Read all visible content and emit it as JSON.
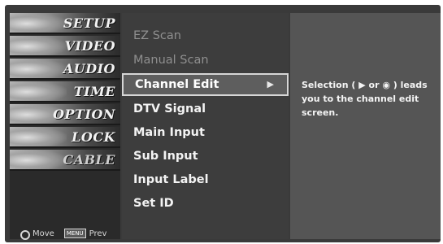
{
  "categories": [
    {
      "label": "SETUP",
      "icon": "setup-icon"
    },
    {
      "label": "VIDEO",
      "icon": "video-icon"
    },
    {
      "label": "AUDIO",
      "icon": "audio-icon"
    },
    {
      "label": "TIME",
      "icon": "clock-icon"
    },
    {
      "label": "OPTION",
      "icon": "option-icon"
    },
    {
      "label": "LOCK",
      "icon": "lock-icon"
    },
    {
      "label": "CABLE",
      "icon": "cable-icon"
    }
  ],
  "legend": {
    "move_label": "Move",
    "prev_key": "MENU",
    "prev_label": "Prev"
  },
  "menu": {
    "items": [
      {
        "label": "EZ Scan",
        "state": "disabled"
      },
      {
        "label": "Manual Scan",
        "state": "disabled"
      },
      {
        "label": "Channel Edit",
        "state": "selected",
        "arrow": "▶"
      },
      {
        "label": "DTV Signal",
        "state": "normal"
      },
      {
        "label": "Main Input",
        "state": "normal"
      },
      {
        "label": "Sub Input",
        "state": "normal"
      },
      {
        "label": "Input Label",
        "state": "normal"
      },
      {
        "label": "Set ID",
        "state": "normal"
      }
    ]
  },
  "description": {
    "text": "Selection ( ▶ or ◉ ) leads\nyou to the channel edit\nscreen."
  }
}
